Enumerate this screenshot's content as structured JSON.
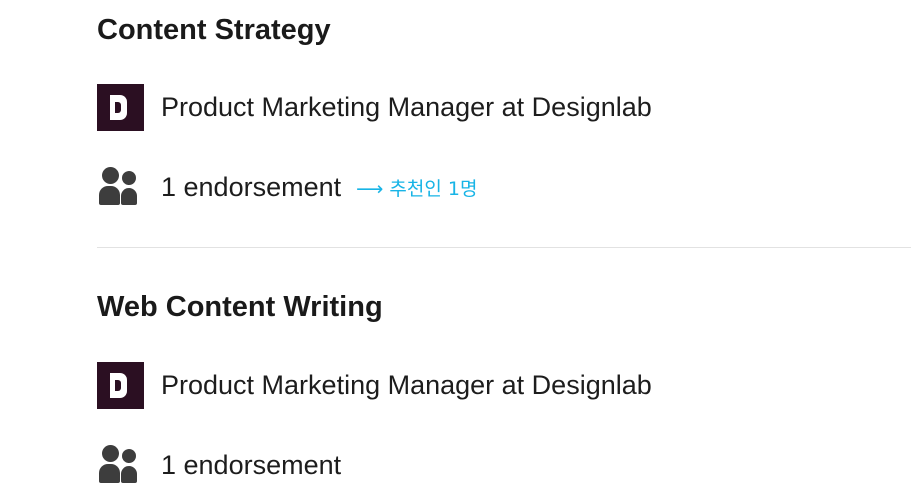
{
  "skills": [
    {
      "title": "Content Strategy",
      "experience": "Product Marketing Manager at Designlab",
      "endorsements": "1 endorsement",
      "annotation": "⟶ 추천인 1명"
    },
    {
      "title": "Web Content Writing",
      "experience": "Product Marketing Manager at Designlab",
      "endorsements": "1 endorsement"
    }
  ],
  "icons": {
    "company_logo": "designlab-logo-icon",
    "endorsement": "people-icon"
  },
  "colors": {
    "logo_background": "#2b0f22",
    "annotation": "#18b4e6",
    "icon": "#3d3d3d",
    "divider": "#e2e2e2"
  }
}
